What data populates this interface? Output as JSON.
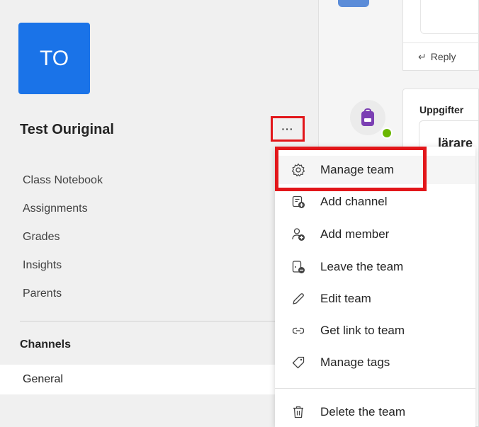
{
  "team": {
    "avatar_initials": "TO",
    "name": "Test Ouriginal",
    "more_label": "···"
  },
  "nav": {
    "items": [
      {
        "label": "Class Notebook"
      },
      {
        "label": "Assignments"
      },
      {
        "label": "Grades"
      },
      {
        "label": "Insights"
      },
      {
        "label": "Parents"
      }
    ]
  },
  "channels": {
    "header": "Channels",
    "items": [
      {
        "label": "General"
      }
    ]
  },
  "chat": {
    "reply_label": "Reply",
    "card_title": "Uppgifter",
    "card_partial_text": "lärare"
  },
  "menu": {
    "items": [
      {
        "label": "Manage team",
        "icon": "gear-icon"
      },
      {
        "label": "Add channel",
        "icon": "add-channel-icon"
      },
      {
        "label": "Add member",
        "icon": "add-member-icon"
      },
      {
        "label": "Leave the team",
        "icon": "leave-team-icon"
      },
      {
        "label": "Edit team",
        "icon": "pencil-icon"
      },
      {
        "label": "Get link to team",
        "icon": "link-icon"
      },
      {
        "label": "Manage tags",
        "icon": "tag-icon"
      },
      {
        "label": "Delete the team",
        "icon": "trash-icon"
      }
    ]
  },
  "colors": {
    "accent": "#1a73e8",
    "highlight_border": "#e2161a",
    "status_available": "#6bb700",
    "assignments_purple": "#7b3fb3"
  }
}
